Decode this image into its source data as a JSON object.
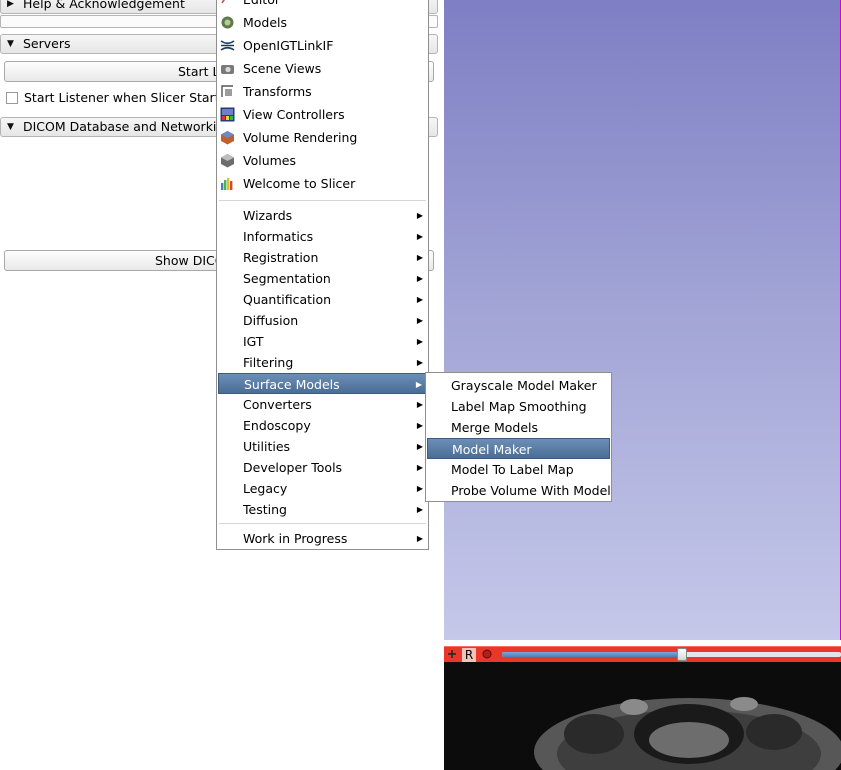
{
  "left_panel": {
    "sections": [
      {
        "label": "Help & Acknowledgement",
        "expanded": false
      },
      {
        "label": "Servers",
        "expanded": true
      },
      {
        "label": "DICOM Database and Networking",
        "expanded": true
      }
    ],
    "start_listener_button": "Start Listener",
    "start_listener_checkbox": "Start Listener when Slicer Starts",
    "show_dicom_button": "Show DICOM Browser"
  },
  "modules_menu": {
    "items_top": [
      {
        "label": "Editor",
        "icon": "editor-icon"
      },
      {
        "label": "Models",
        "icon": "models-icon"
      },
      {
        "label": "OpenIGTLinkIF",
        "icon": "openigtlink-icon"
      },
      {
        "label": "Scene Views",
        "icon": "scene-views-icon"
      },
      {
        "label": "Transforms",
        "icon": "transforms-icon"
      },
      {
        "label": "View Controllers",
        "icon": "view-controllers-icon"
      },
      {
        "label": "Volume Rendering",
        "icon": "volume-rendering-icon"
      },
      {
        "label": "Volumes",
        "icon": "volumes-icon"
      },
      {
        "label": "Welcome to Slicer",
        "icon": "welcome-icon"
      }
    ],
    "categories": [
      {
        "label": "Wizards"
      },
      {
        "label": "Informatics"
      },
      {
        "label": "Registration"
      },
      {
        "label": "Segmentation"
      },
      {
        "label": "Quantification"
      },
      {
        "label": "Diffusion"
      },
      {
        "label": "IGT"
      },
      {
        "label": "Filtering"
      },
      {
        "label": "Surface Models",
        "active": true
      },
      {
        "label": "Converters"
      },
      {
        "label": "Endoscopy"
      },
      {
        "label": "Utilities"
      },
      {
        "label": "Developer Tools"
      },
      {
        "label": "Legacy"
      },
      {
        "label": "Testing"
      }
    ],
    "work_in_progress": "Work in Progress"
  },
  "surface_models_submenu": {
    "items": [
      {
        "label": "Grayscale Model Maker"
      },
      {
        "label": "Label Map Smoothing"
      },
      {
        "label": "Merge Models"
      },
      {
        "label": "Model Maker",
        "active": true
      },
      {
        "label": "Model To Label Map"
      },
      {
        "label": "Probe Volume With Model"
      }
    ]
  },
  "slice_view": {
    "orientation_label": "R",
    "pin_icon": "pin-icon",
    "link_icon": "link-icon",
    "slider_fraction": 0.53
  },
  "colors": {
    "view3d_top": "#7e7fc4",
    "view3d_bottom": "#c5c8e9",
    "slice_bar": "#e8382a",
    "menu_highlight": "#5a7ca4"
  }
}
